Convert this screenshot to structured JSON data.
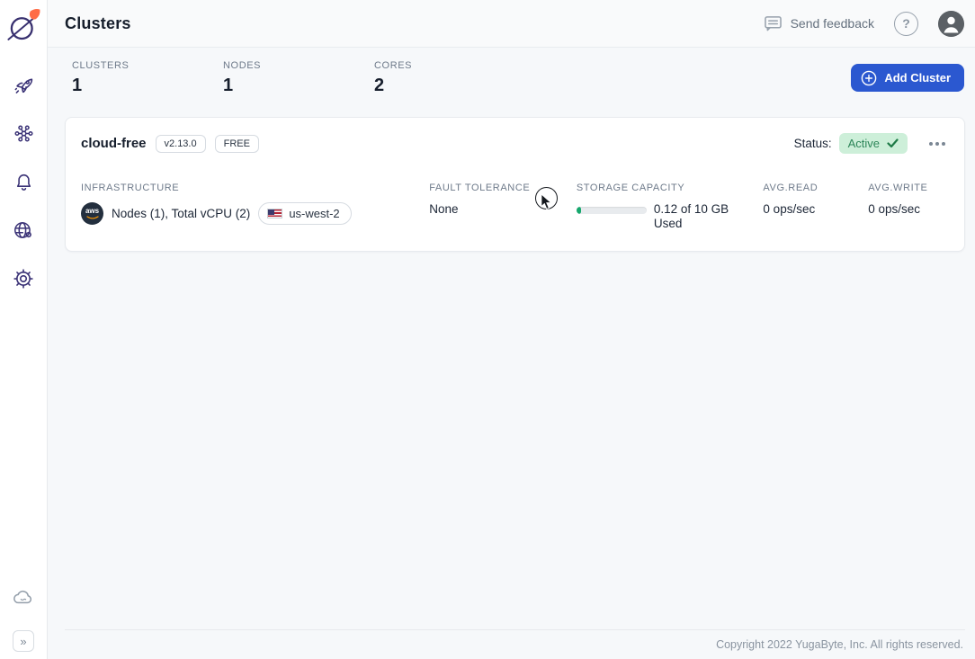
{
  "colors": {
    "primary_blue": "#2B58D0",
    "brand_indigo": "#38306F",
    "brand_orange": "#FF6C47",
    "status_active_bg": "#CDEFD9",
    "status_active_text": "#2D8659",
    "progress_fill": "#16A86D",
    "aws_navy": "#232F3E"
  },
  "sidebar": {
    "logo_icon": "yugabyte-logo",
    "items": [
      {
        "icon": "rocket-icon"
      },
      {
        "icon": "clusters-network-icon"
      },
      {
        "icon": "alerts-bell-icon"
      },
      {
        "icon": "network-access-globe-gear-icon"
      },
      {
        "icon": "settings-gear-icon"
      }
    ],
    "bottom": {
      "cloud_icon": "cloud-icon",
      "expand_glyph": "»"
    }
  },
  "header": {
    "title": "Clusters",
    "feedback_label": "Send feedback",
    "help_glyph": "?",
    "icons": [
      "feedback-message-icon",
      "help-circle-icon",
      "user-avatar-icon"
    ]
  },
  "stats": {
    "items": [
      {
        "label": "CLUSTERS",
        "value": "1"
      },
      {
        "label": "NODES",
        "value": "1"
      },
      {
        "label": "CORES",
        "value": "2"
      }
    ],
    "add_cluster_label": "Add Cluster"
  },
  "cluster": {
    "name": "cloud-free",
    "version": "v2.13.0",
    "tier": "FREE",
    "status_label": "Status:",
    "status_value": "Active",
    "infrastructure": {
      "label": "INFRASTRUCTURE",
      "provider": "aws",
      "text": "Nodes (1), Total vCPU (2)",
      "region": "us-west-2"
    },
    "fault_tolerance": {
      "label": "FAULT TOLERANCE",
      "value": "None"
    },
    "storage": {
      "label": "STORAGE CAPACITY",
      "text": "0.12 of 10 GB Used",
      "used_gb": 0.12,
      "total_gb": 10,
      "percent_used": 1.2
    },
    "avg_read": {
      "label": "AVG.READ",
      "value": "0 ops/sec"
    },
    "avg_write": {
      "label": "AVG.WRITE",
      "value": "0 ops/sec"
    }
  },
  "footer": {
    "copyright": "Copyright 2022 YugaByte, Inc. All rights reserved."
  }
}
